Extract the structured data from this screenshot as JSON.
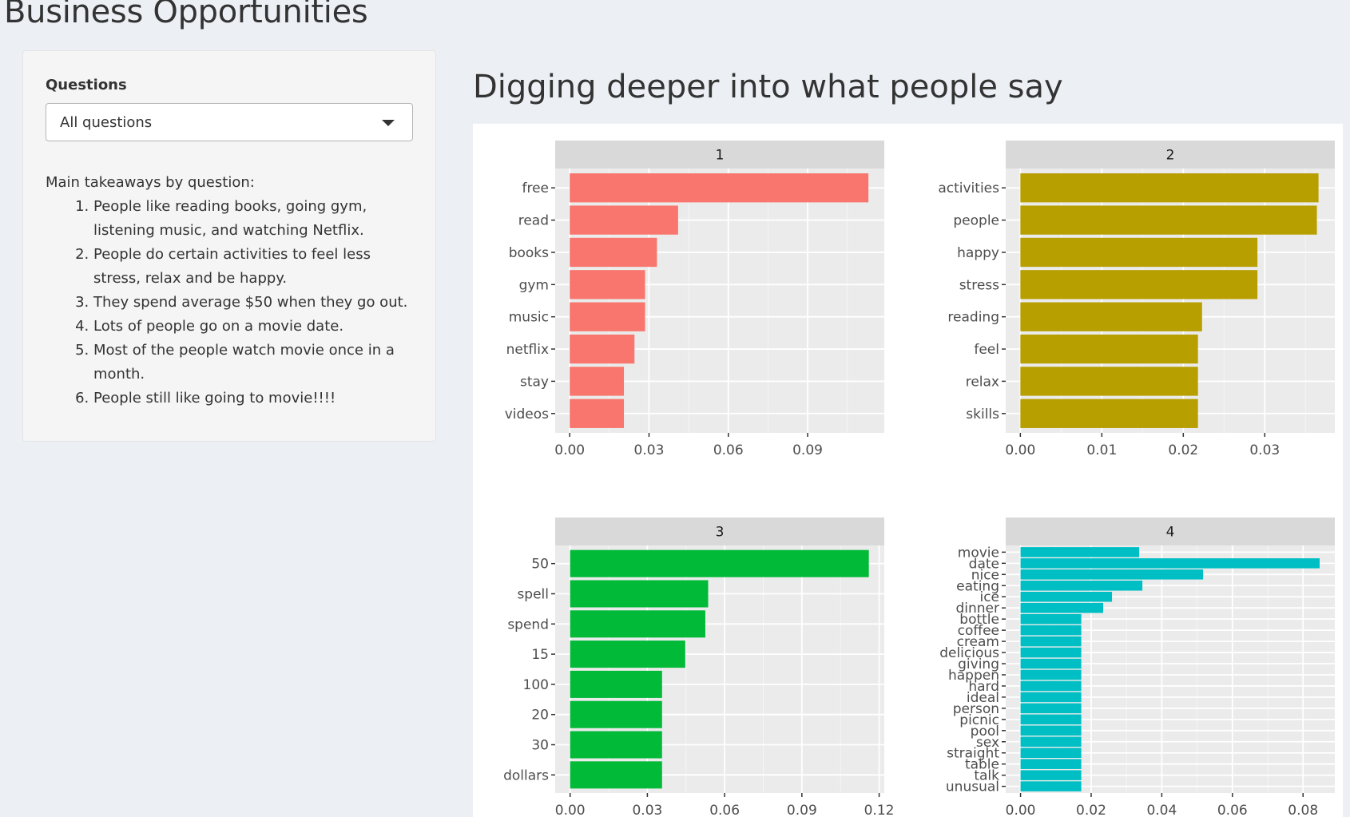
{
  "app": {
    "title": "Business Opportunities"
  },
  "sidebar": {
    "questions_label": "Questions",
    "select_value": "All questions",
    "takeaways_title": "Main takeaways by question:",
    "takeaways": [
      "People like reading books, going gym, listening music, and watching Netflix.",
      "People do certain activities to feel less stress, relax and be happy.",
      "They spend average $50 when they go out.",
      "Lots of people go on a movie date.",
      "Most of the people watch movie once in a month.",
      "People still like going to movie!!!!"
    ]
  },
  "main": {
    "heading": "Digging deeper into what people say"
  },
  "chart_data": [
    {
      "type": "bar",
      "orientation": "horizontal",
      "facet": "1",
      "color": "#F8766D",
      "categories": [
        "free",
        "read",
        "books",
        "gym",
        "music",
        "netflix",
        "stay",
        "videos"
      ],
      "values": [
        0.113,
        0.041,
        0.033,
        0.0285,
        0.0285,
        0.0245,
        0.0205,
        0.0205
      ],
      "xlim": [
        -0.0055,
        0.119
      ],
      "xticks": [
        "0.00",
        "0.03",
        "0.06",
        "0.09"
      ],
      "xtick_values": [
        0,
        0.03,
        0.06,
        0.09
      ],
      "grid": true
    },
    {
      "type": "bar",
      "orientation": "horizontal",
      "facet": "2",
      "color": "#B79F00",
      "categories": [
        "activities",
        "people",
        "happy",
        "stress",
        "reading",
        "feel",
        "relax",
        "skills"
      ],
      "values": [
        0.0366,
        0.0364,
        0.0291,
        0.0291,
        0.0223,
        0.0218,
        0.0218,
        0.0218
      ],
      "xlim": [
        -0.0018,
        0.0386
      ],
      "xticks": [
        "0.00",
        "0.01",
        "0.02",
        "0.03"
      ],
      "xtick_values": [
        0,
        0.01,
        0.02,
        0.03
      ],
      "grid": true
    },
    {
      "type": "bar",
      "orientation": "horizontal",
      "facet": "3",
      "color": "#00BA38",
      "categories": [
        "50",
        "spell",
        "spend",
        "15",
        "100",
        "20",
        "30",
        "dollars"
      ],
      "values": [
        0.116,
        0.0536,
        0.0525,
        0.0447,
        0.0357,
        0.0357,
        0.0357,
        0.0357
      ],
      "xlim": [
        -0.0058,
        0.122
      ],
      "xticks": [
        "0.00",
        "0.03",
        "0.06",
        "0.09",
        "0.12"
      ],
      "xtick_values": [
        0,
        0.03,
        0.06,
        0.09,
        0.12
      ],
      "grid": true
    },
    {
      "type": "bar",
      "orientation": "horizontal",
      "facet": "4",
      "color": "#00BFC4",
      "categories": [
        "movie",
        "date",
        "nice",
        "eating",
        "ice",
        "dinner",
        "bottle",
        "coffee",
        "cream",
        "delicious",
        "giving",
        "happen",
        "hard",
        "ideal",
        "person",
        "picnic",
        "pool",
        "sex",
        "straight",
        "table",
        "talk",
        "unusual"
      ],
      "values": [
        0.0336,
        0.0847,
        0.0517,
        0.0345,
        0.0259,
        0.0234,
        0.0172,
        0.0172,
        0.0172,
        0.0172,
        0.0172,
        0.0172,
        0.0172,
        0.0172,
        0.0172,
        0.0172,
        0.0172,
        0.0172,
        0.0172,
        0.0172,
        0.0172,
        0.0172
      ],
      "xlim": [
        -0.0042,
        0.089
      ],
      "xticks": [
        "0.00",
        "0.02",
        "0.04",
        "0.06",
        "0.08"
      ],
      "xtick_values": [
        0,
        0.02,
        0.04,
        0.06,
        0.08
      ],
      "grid": true
    }
  ]
}
